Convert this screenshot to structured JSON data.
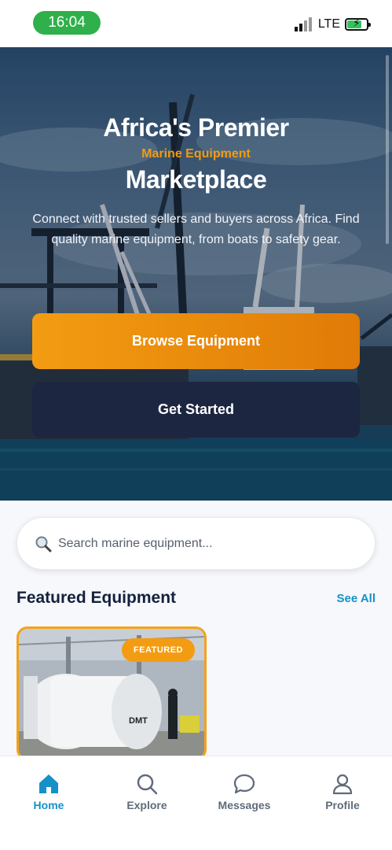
{
  "status_bar": {
    "time": "16:04",
    "network": "LTE"
  },
  "hero": {
    "title_line1": "Africa's Premier",
    "subtitle": "Marine Equipment",
    "title_line2": "Marketplace",
    "description": "Connect with trusted sellers and buyers across Africa. Find quality marine equipment, from boats to safety gear.",
    "browse_button": "Browse Equipment",
    "start_button": "Get Started"
  },
  "search": {
    "placeholder": "Search marine equipment..."
  },
  "featured": {
    "title": "Featured Equipment",
    "see_all": "See All",
    "cards": [
      {
        "badge": "FEATURED",
        "brand_text": "DMT"
      }
    ]
  },
  "bottom_nav": {
    "items": [
      {
        "label": "Home",
        "icon": "home-icon",
        "active": true
      },
      {
        "label": "Explore",
        "icon": "search-icon",
        "active": false
      },
      {
        "label": "Messages",
        "icon": "chat-icon",
        "active": false
      },
      {
        "label": "Profile",
        "icon": "user-icon",
        "active": false
      }
    ]
  },
  "colors": {
    "accent_orange": "#f39c12",
    "dark_navy": "#1c2640",
    "link_blue": "#1591c7"
  }
}
